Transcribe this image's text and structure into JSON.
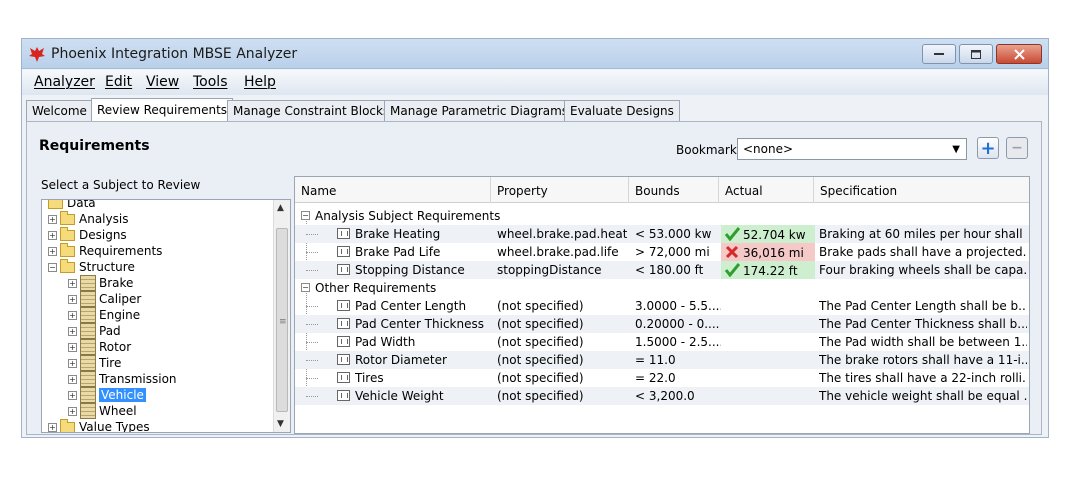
{
  "window": {
    "title": "Phoenix Integration MBSE Analyzer"
  },
  "menu": [
    "Analyzer",
    "Edit",
    "View",
    "Tools",
    "Help"
  ],
  "tabs": [
    {
      "label": "Welcome",
      "active": false
    },
    {
      "label": "Review Requirements",
      "active": true
    },
    {
      "label": "Manage Constraint Blocks",
      "active": false
    },
    {
      "label": "Manage Parametric Diagrams",
      "active": false
    },
    {
      "label": "Evaluate Designs",
      "active": false
    }
  ],
  "requirements": {
    "title": "Requirements",
    "bookmark_label": "Bookmark",
    "bookmark_value": "<none>",
    "add_glyph": "+",
    "remove_glyph": "−",
    "subject_label": "Select a Subject to Review"
  },
  "tree": [
    {
      "label": "Data",
      "type": "folder",
      "expander": "−"
    },
    {
      "label": "Analysis",
      "type": "folder",
      "expander": "+"
    },
    {
      "label": "Designs",
      "type": "folder",
      "expander": "+"
    },
    {
      "label": "Requirements",
      "type": "folder",
      "expander": "+"
    },
    {
      "label": "Structure",
      "type": "folder",
      "expander": "−"
    },
    {
      "label": "Brake",
      "type": "block",
      "expander": "+"
    },
    {
      "label": "Caliper",
      "type": "block",
      "expander": "+"
    },
    {
      "label": "Engine",
      "type": "block",
      "expander": "+"
    },
    {
      "label": "Pad",
      "type": "block",
      "expander": "+"
    },
    {
      "label": "Rotor",
      "type": "block",
      "expander": "+"
    },
    {
      "label": "Tire",
      "type": "block",
      "expander": "+"
    },
    {
      "label": "Transmission",
      "type": "block",
      "expander": "+"
    },
    {
      "label": "Vehicle",
      "type": "block",
      "expander": "+",
      "selected": true
    },
    {
      "label": "Wheel",
      "type": "block",
      "expander": "+"
    },
    {
      "label": "Value Types",
      "type": "folder",
      "expander": "+"
    }
  ],
  "table": {
    "columns": [
      "Name",
      "Property",
      "Bounds",
      "Actual",
      "Specification"
    ],
    "groups": [
      {
        "label": "Analysis Subject Requirements",
        "rows": [
          {
            "name": "Brake Heating",
            "property": "wheel.brake.pad.heat",
            "bounds": "< 53.000 kw",
            "actual": "52.704 kw",
            "status": "pass",
            "spec": "Braking at 60 miles per hour shall ..."
          },
          {
            "name": "Brake Pad Life",
            "property": "wheel.brake.pad.life",
            "bounds": "> 72,000 mi",
            "actual": "36,016 mi",
            "status": "fail",
            "spec": "Brake pads shall have a projected..."
          },
          {
            "name": "Stopping Distance",
            "property": "stoppingDistance",
            "bounds": "< 180.00 ft",
            "actual": "174.22 ft",
            "status": "pass",
            "spec": "Four braking wheels shall be capa..."
          }
        ]
      },
      {
        "label": "Other Requirements",
        "rows": [
          {
            "name": "Pad Center Length",
            "property": "(not specified)",
            "bounds": "3.0000 - 5.5....",
            "actual": "",
            "status": "none",
            "spec": "The Pad Center Length shall be b..."
          },
          {
            "name": "Pad Center Thickness",
            "property": "(not specified)",
            "bounds": "0.20000 - 0....",
            "actual": "",
            "status": "none",
            "spec": "The Pad Center Thickness shall b..."
          },
          {
            "name": "Pad Width",
            "property": "(not specified)",
            "bounds": "1.5000 - 2.5....",
            "actual": "",
            "status": "none",
            "spec": "The Pad width shall be between 1..."
          },
          {
            "name": "Rotor Diameter",
            "property": "(not specified)",
            "bounds": "= 11.0",
            "actual": "",
            "status": "none",
            "spec": "The brake rotors shall have a 11-i..."
          },
          {
            "name": "Tires",
            "property": "(not specified)",
            "bounds": "= 22.0",
            "actual": "",
            "status": "none",
            "spec": "The tires shall have a 22-inch rolli..."
          },
          {
            "name": "Vehicle Weight",
            "property": "(not specified)",
            "bounds": "< 3,200.0",
            "actual": "",
            "status": "none",
            "spec": "The vehicle weight shall be equal ..."
          }
        ]
      }
    ]
  },
  "colors": {
    "pass": "#2e9e2e",
    "fail": "#d42a2a",
    "selection": "#3390ff"
  }
}
